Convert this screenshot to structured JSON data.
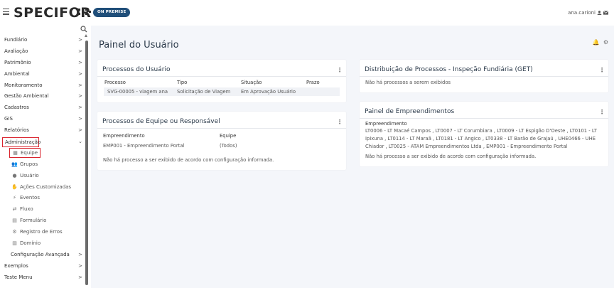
{
  "header": {
    "brand": "SPECIFOR",
    "badge": "ON PREMISE",
    "username": "ana.carioni"
  },
  "sidebar": {
    "items": [
      {
        "label": "Fundiário",
        "chevron": ">"
      },
      {
        "label": "Avaliação",
        "chevron": ">"
      },
      {
        "label": "Patrimônio",
        "chevron": ">"
      },
      {
        "label": "Ambiental",
        "chevron": ">"
      },
      {
        "label": "Monitoramento",
        "chevron": ">"
      },
      {
        "label": "Gestão Ambiental",
        "chevron": ">"
      },
      {
        "label": "Cadastros",
        "chevron": ">"
      },
      {
        "label": "GIS",
        "chevron": ">"
      },
      {
        "label": "Relatórios",
        "chevron": ">"
      },
      {
        "label": "Administração",
        "chevron": "⌄"
      }
    ],
    "admin_sub": [
      {
        "label": "Equipe",
        "icon": "team-icon"
      },
      {
        "label": "Grupos",
        "icon": "groups-icon"
      },
      {
        "label": "Usuário",
        "icon": "user-icon"
      },
      {
        "label": "Ações Customizadas",
        "icon": "custom-actions-icon"
      },
      {
        "label": "Eventos",
        "icon": "events-icon"
      },
      {
        "label": "Fluxo",
        "icon": "flow-icon"
      },
      {
        "label": "Formulário",
        "icon": "form-icon"
      },
      {
        "label": "Registro de Erros",
        "icon": "error-log-icon"
      },
      {
        "label": "Domínio",
        "icon": "domain-icon"
      }
    ],
    "config": {
      "label": "Configuração Avançada",
      "chevron": ">"
    },
    "bottom": [
      {
        "label": "Exemplos",
        "chevron": ">"
      },
      {
        "label": "Teste Menu",
        "chevron": ">"
      }
    ]
  },
  "main": {
    "title": "Painel do Usuário",
    "card_user_processes": {
      "title": "Processos do Usuário",
      "headers": [
        "Processo",
        "Tipo",
        "Situação",
        "Prazo"
      ],
      "row": [
        "SVG-00005 - viagem ana",
        "Solicitação de Viagem",
        "Em Aprovação Usuário",
        ""
      ]
    },
    "card_team_processes": {
      "title": "Processos de Equipe ou Responsável",
      "headers": [
        "Empreendimento",
        "Equipe"
      ],
      "row": [
        "EMP001 - Empreendimento Portal",
        "(Todos)"
      ],
      "message": "Não há processo a ser exibido de acordo com configuração informada."
    },
    "card_distribution": {
      "title": "Distribuição de Processos - Inspeção Fundiária (GET)",
      "message": "Não há processos a serem exibidos"
    },
    "card_enterprises": {
      "title": "Painel de Empreendimentos",
      "label": "Empreendimento",
      "line1": "LT0006 - LT Macaé Campos , LT0007 - LT Corumbiara , LT0009 - LT Espigão D'Oeste , LT0101 - LT",
      "line2": "Ipixuna , LT0114 - LT Maraã , LT0181 - LT Angico , LT0338 - LT Barão de Grajaú , UHE0466 - UHE",
      "line3": "Chiador , LT0025 - ATAM Empreendimentos Ltda , EMP001 - Empreendimento Portal",
      "message": "Não há processo a ser exibido de acordo com configuração informada."
    }
  }
}
